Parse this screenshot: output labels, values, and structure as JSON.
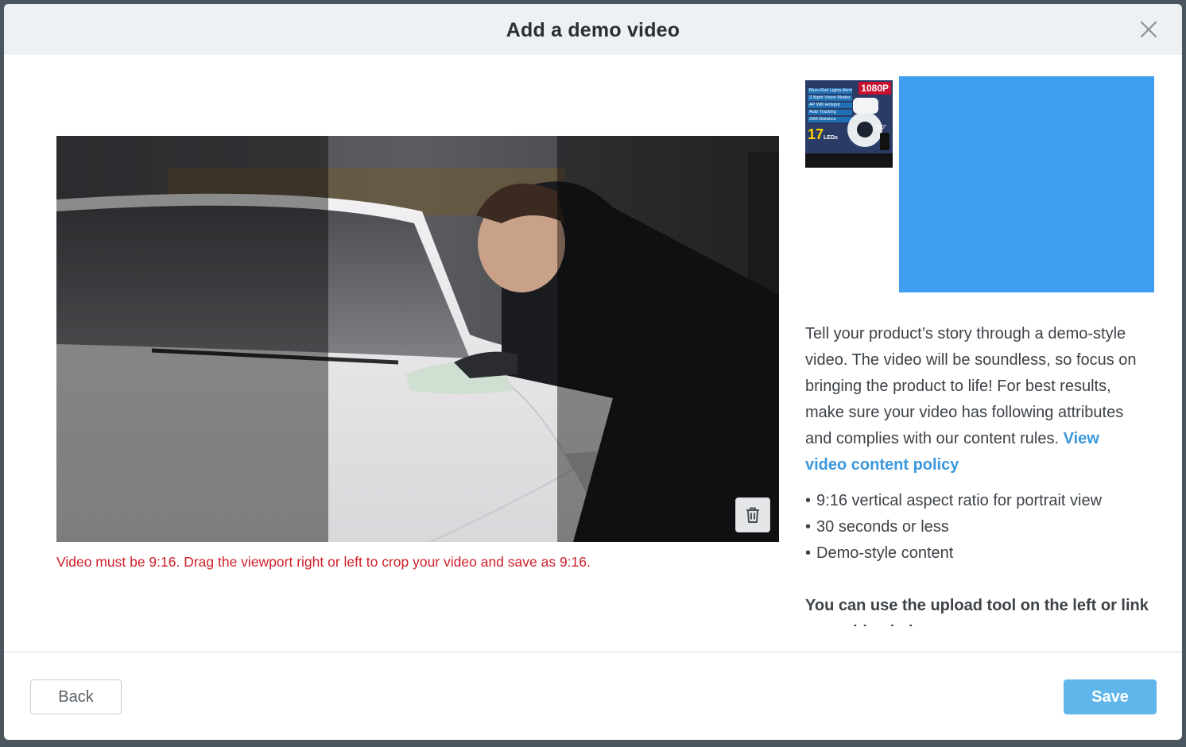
{
  "modal": {
    "title": "Add a demo video"
  },
  "video": {
    "crop_warning": "Video must be 9:16. Drag the viewport right or left to crop your video and save as 9:16."
  },
  "thumbnail": {
    "badge": "1080P",
    "feature_lines": [
      "Blue+Red Lights Alerts",
      "3 Night Vision Modes",
      "AP Wifi Hotspot",
      "Auto Tracking",
      "20M Distance"
    ],
    "led_count": "17",
    "led_label": "LEDs",
    "rotation_label": "320°"
  },
  "info": {
    "description": "Tell your product’s story through a demo-style video. The video will be soundless, so focus on bringing the product to life! For best results, make sure your video has following attributes and complies with our content rules.",
    "policy_link": "View video content policy",
    "bullets": [
      "9:16 vertical aspect ratio for portrait view",
      "30 seconds or less",
      "Demo-style content"
    ],
    "upload_note": "You can use the upload tool on the left or link your video below."
  },
  "footer": {
    "back_label": "Back",
    "save_label": "Save"
  },
  "colors": {
    "accent_blue": "#3f9ef1",
    "save_button": "#5eb6ea",
    "link": "#3a98dd",
    "error_red": "#d0202a"
  }
}
